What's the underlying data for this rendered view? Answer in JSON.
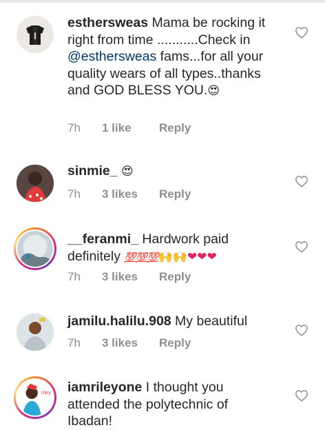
{
  "comments": [
    {
      "username": "esthersweas",
      "text_before": " Mama be rocking it right from time ...........Check in ",
      "mention": "@esthersweas",
      "text_after": " fams...for all your quality wears of all types..thanks and GOD BLESS YOU.",
      "emoji": "😍",
      "time": "7h",
      "likes": "1 like",
      "reply": "Reply"
    },
    {
      "username": "sinmie_",
      "text": " ",
      "emoji": "😍",
      "time": "7h",
      "likes": "3 likes",
      "reply": "Reply"
    },
    {
      "username": "__feranmi_",
      "text": " Hardwork paid definitely ",
      "emoji_hundreds": "💯💯💯",
      "emoji_hands": "🙌🙌",
      "emoji_hearts": "❤❤❤",
      "time": "7h",
      "likes": "3 likes",
      "reply": "Reply"
    },
    {
      "username": "jamilu.halilu.908",
      "text": " My beautiful",
      "time": "7h",
      "likes": "3 likes",
      "reply": "Reply"
    },
    {
      "username": "iamrileyone",
      "text": " I thought you attended the polytechnic of Ibadan!"
    }
  ],
  "icons": {
    "like": "heart-outline-icon"
  },
  "colors": {
    "text": "#262626",
    "secondary": "#8e8e8e",
    "mention": "#00376b"
  }
}
